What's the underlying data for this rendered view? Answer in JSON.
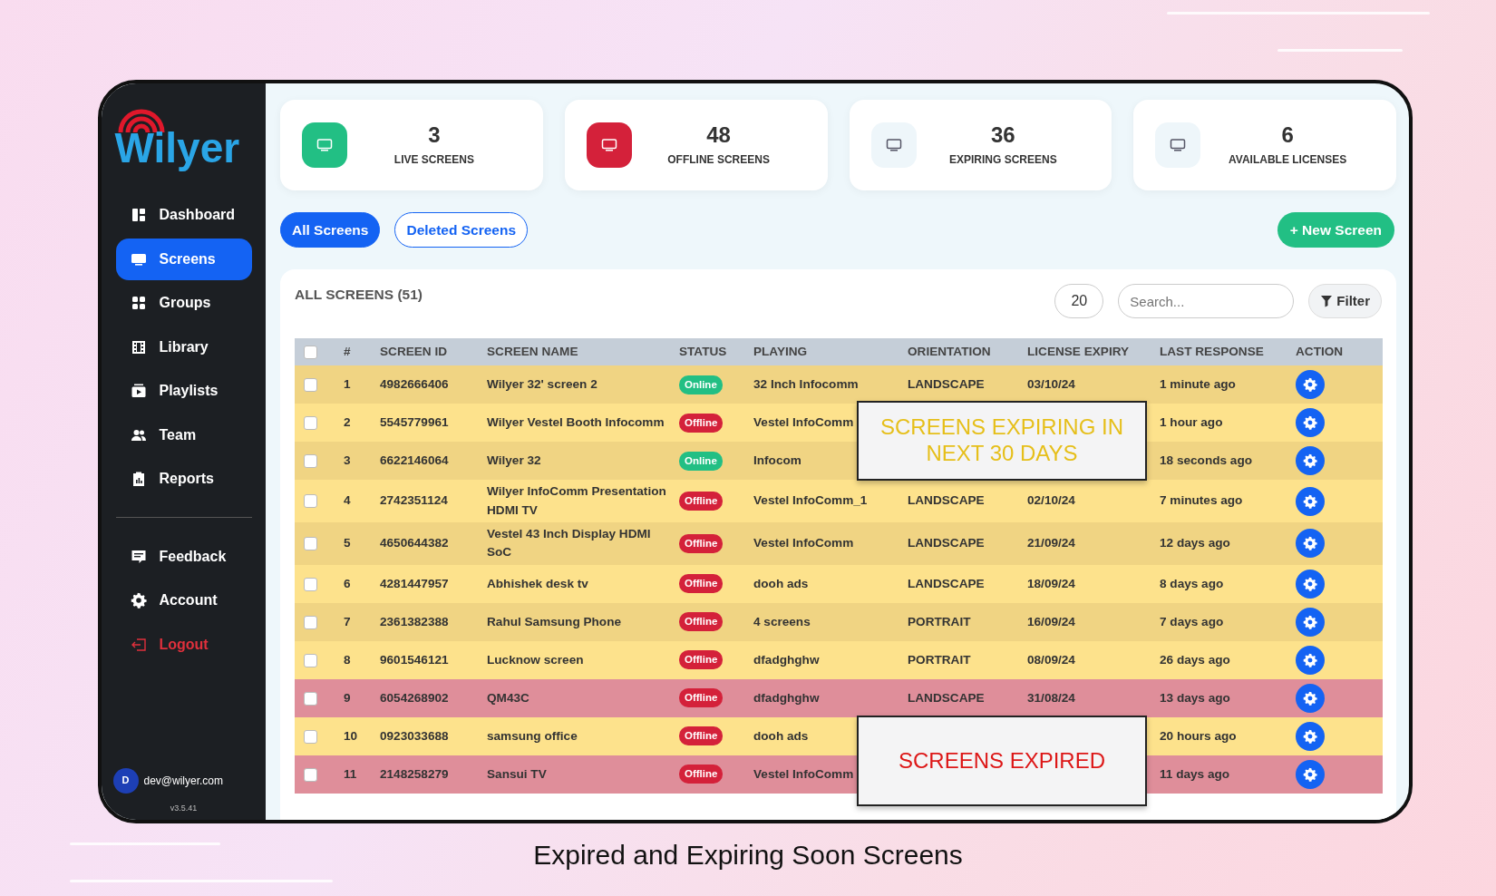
{
  "sidebar": {
    "logo": "Wilyer",
    "items": [
      {
        "label": "Dashboard",
        "selected": false
      },
      {
        "label": "Screens",
        "selected": true
      },
      {
        "label": "Groups",
        "selected": false
      },
      {
        "label": "Library",
        "selected": false
      },
      {
        "label": "Playlists",
        "selected": false
      },
      {
        "label": "Team",
        "selected": false
      },
      {
        "label": "Reports",
        "selected": false
      }
    ],
    "bottom_items": [
      {
        "label": "Feedback",
        "kind": "normal"
      },
      {
        "label": "Account",
        "kind": "normal"
      },
      {
        "label": "Logout",
        "kind": "danger"
      }
    ],
    "user": {
      "avatar": "D",
      "email": "dev@wilyer.com"
    },
    "version": "v3.5.41"
  },
  "stats": [
    {
      "value": "3",
      "label": "LIVE SCREENS",
      "kind": "success"
    },
    {
      "value": "48",
      "label": "OFFLINE SCREENS",
      "kind": "danger"
    },
    {
      "value": "36",
      "label": "EXPIRING SCREENS",
      "kind": "light"
    },
    {
      "value": "6",
      "label": "AVAILABLE LICENSES",
      "kind": "light"
    }
  ],
  "tabs": [
    {
      "label": "All Screens",
      "selected": true
    },
    {
      "label": "Deleted Screens",
      "selected": false
    }
  ],
  "new_button": "+ New Screen",
  "table": {
    "title": "ALL SCREENS (51)",
    "page_size": "20",
    "search": {
      "placeholder": "Search..."
    },
    "filter_button": "Filter",
    "select_all": {
      "checked": false
    },
    "columns": [
      "#",
      "SCREEN ID",
      "SCREEN NAME",
      "STATUS",
      "PLAYING",
      "ORIENTATION",
      "LICENSE EXPIRY",
      "LAST RESPONSE",
      "ACTION"
    ],
    "rows": [
      {
        "kind": "expiring",
        "checked": false,
        "number": "1",
        "screen_id": "4982666406",
        "name": "Wilyer 32' screen 2",
        "status": {
          "label": "Online",
          "kind": "online"
        },
        "playing": "32 Inch Infocomm",
        "orientation": "LANDSCAPE",
        "license_expiry": "03/10/24",
        "last_response": "1 minute ago"
      },
      {
        "kind": "expiring",
        "checked": false,
        "number": "2",
        "screen_id": "5545779961",
        "name": "Wilyer Vestel Booth Infocomm",
        "status": {
          "label": "Offline",
          "kind": "offline"
        },
        "playing": "Vestel InfoComm",
        "last_response": "1 hour ago"
      },
      {
        "kind": "expiring",
        "checked": false,
        "number": "3",
        "screen_id": "6622146064",
        "name": "Wilyer 32",
        "status": {
          "label": "Online",
          "kind": "online"
        },
        "playing": "Infocom",
        "last_response": "18 seconds ago"
      },
      {
        "kind": "expiring",
        "checked": false,
        "number": "4",
        "screen_id": "2742351124",
        "name": "Wilyer InfoComm Presentation HDMI TV",
        "status": {
          "label": "Offline",
          "kind": "offline"
        },
        "playing": "Vestel InfoComm_1",
        "orientation": "LANDSCAPE",
        "license_expiry": "02/10/24",
        "last_response": "7 minutes ago"
      },
      {
        "kind": "expiring",
        "checked": false,
        "number": "5",
        "screen_id": "4650644382",
        "name": "Vestel 43 Inch Display HDMI SoC",
        "status": {
          "label": "Offline",
          "kind": "offline"
        },
        "playing": "Vestel InfoComm",
        "orientation": "LANDSCAPE",
        "license_expiry": "21/09/24",
        "last_response": "12 days ago"
      },
      {
        "kind": "expiring",
        "checked": false,
        "number": "6",
        "screen_id": "4281447957",
        "name": "Abhishek desk tv",
        "status": {
          "label": "Offline",
          "kind": "offline"
        },
        "playing": "dooh ads",
        "orientation": "LANDSCAPE",
        "license_expiry": "18/09/24",
        "last_response": "8 days ago"
      },
      {
        "kind": "expiring",
        "checked": false,
        "number": "7",
        "screen_id": "2361382388",
        "name": "Rahul Samsung Phone",
        "status": {
          "label": "Offline",
          "kind": "offline"
        },
        "playing": "4 screens",
        "orientation": "PORTRAIT",
        "license_expiry": "16/09/24",
        "last_response": "7 days ago"
      },
      {
        "kind": "expiring",
        "checked": false,
        "number": "8",
        "screen_id": "9601546121",
        "name": "Lucknow screen",
        "status": {
          "label": "Offline",
          "kind": "offline"
        },
        "playing": "dfadghghw",
        "orientation": "PORTRAIT",
        "license_expiry": "08/09/24",
        "last_response": "26 days ago"
      },
      {
        "kind": "expired",
        "checked": false,
        "number": "9",
        "screen_id": "6054268902",
        "name": "QM43C",
        "status": {
          "label": "Offline",
          "kind": "offline"
        },
        "playing": "dfadghghw",
        "orientation": "LANDSCAPE",
        "license_expiry": "31/08/24",
        "last_response": "13 days ago"
      },
      {
        "kind": "expiring",
        "checked": false,
        "number": "10",
        "screen_id": "0923033688",
        "name": "samsung office",
        "status": {
          "label": "Offline",
          "kind": "offline"
        },
        "playing": "dooh ads",
        "last_response": "20 hours ago"
      },
      {
        "kind": "expired",
        "checked": false,
        "number": "11",
        "screen_id": "2148258279",
        "name": "Sansui TV",
        "status": {
          "label": "Offline",
          "kind": "offline"
        },
        "playing": "Vestel InfoComm",
        "last_response": "11 days ago"
      }
    ]
  },
  "callouts": [
    {
      "text": "SCREENS EXPIRING IN NEXT 30 DAYS",
      "kind": "expiring"
    },
    {
      "text": "SCREENS EXPIRED",
      "kind": "expired"
    }
  ],
  "caption": "Expired and Expiring Soon Screens"
}
